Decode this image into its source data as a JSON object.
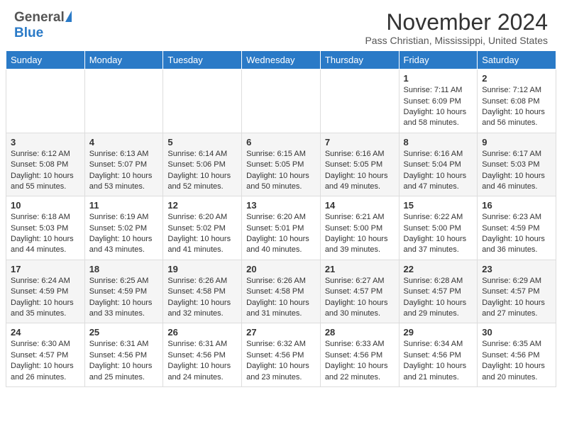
{
  "header": {
    "logo_general": "General",
    "logo_blue": "Blue",
    "month": "November 2024",
    "location": "Pass Christian, Mississippi, United States"
  },
  "calendar": {
    "days_of_week": [
      "Sunday",
      "Monday",
      "Tuesday",
      "Wednesday",
      "Thursday",
      "Friday",
      "Saturday"
    ],
    "weeks": [
      [
        {
          "day": "",
          "info": ""
        },
        {
          "day": "",
          "info": ""
        },
        {
          "day": "",
          "info": ""
        },
        {
          "day": "",
          "info": ""
        },
        {
          "day": "",
          "info": ""
        },
        {
          "day": "1",
          "info": "Sunrise: 7:11 AM\nSunset: 6:09 PM\nDaylight: 10 hours\nand 58 minutes."
        },
        {
          "day": "2",
          "info": "Sunrise: 7:12 AM\nSunset: 6:08 PM\nDaylight: 10 hours\nand 56 minutes."
        }
      ],
      [
        {
          "day": "3",
          "info": "Sunrise: 6:12 AM\nSunset: 5:08 PM\nDaylight: 10 hours\nand 55 minutes."
        },
        {
          "day": "4",
          "info": "Sunrise: 6:13 AM\nSunset: 5:07 PM\nDaylight: 10 hours\nand 53 minutes."
        },
        {
          "day": "5",
          "info": "Sunrise: 6:14 AM\nSunset: 5:06 PM\nDaylight: 10 hours\nand 52 minutes."
        },
        {
          "day": "6",
          "info": "Sunrise: 6:15 AM\nSunset: 5:05 PM\nDaylight: 10 hours\nand 50 minutes."
        },
        {
          "day": "7",
          "info": "Sunrise: 6:16 AM\nSunset: 5:05 PM\nDaylight: 10 hours\nand 49 minutes."
        },
        {
          "day": "8",
          "info": "Sunrise: 6:16 AM\nSunset: 5:04 PM\nDaylight: 10 hours\nand 47 minutes."
        },
        {
          "day": "9",
          "info": "Sunrise: 6:17 AM\nSunset: 5:03 PM\nDaylight: 10 hours\nand 46 minutes."
        }
      ],
      [
        {
          "day": "10",
          "info": "Sunrise: 6:18 AM\nSunset: 5:03 PM\nDaylight: 10 hours\nand 44 minutes."
        },
        {
          "day": "11",
          "info": "Sunrise: 6:19 AM\nSunset: 5:02 PM\nDaylight: 10 hours\nand 43 minutes."
        },
        {
          "day": "12",
          "info": "Sunrise: 6:20 AM\nSunset: 5:02 PM\nDaylight: 10 hours\nand 41 minutes."
        },
        {
          "day": "13",
          "info": "Sunrise: 6:20 AM\nSunset: 5:01 PM\nDaylight: 10 hours\nand 40 minutes."
        },
        {
          "day": "14",
          "info": "Sunrise: 6:21 AM\nSunset: 5:00 PM\nDaylight: 10 hours\nand 39 minutes."
        },
        {
          "day": "15",
          "info": "Sunrise: 6:22 AM\nSunset: 5:00 PM\nDaylight: 10 hours\nand 37 minutes."
        },
        {
          "day": "16",
          "info": "Sunrise: 6:23 AM\nSunset: 4:59 PM\nDaylight: 10 hours\nand 36 minutes."
        }
      ],
      [
        {
          "day": "17",
          "info": "Sunrise: 6:24 AM\nSunset: 4:59 PM\nDaylight: 10 hours\nand 35 minutes."
        },
        {
          "day": "18",
          "info": "Sunrise: 6:25 AM\nSunset: 4:59 PM\nDaylight: 10 hours\nand 33 minutes."
        },
        {
          "day": "19",
          "info": "Sunrise: 6:26 AM\nSunset: 4:58 PM\nDaylight: 10 hours\nand 32 minutes."
        },
        {
          "day": "20",
          "info": "Sunrise: 6:26 AM\nSunset: 4:58 PM\nDaylight: 10 hours\nand 31 minutes."
        },
        {
          "day": "21",
          "info": "Sunrise: 6:27 AM\nSunset: 4:57 PM\nDaylight: 10 hours\nand 30 minutes."
        },
        {
          "day": "22",
          "info": "Sunrise: 6:28 AM\nSunset: 4:57 PM\nDaylight: 10 hours\nand 29 minutes."
        },
        {
          "day": "23",
          "info": "Sunrise: 6:29 AM\nSunset: 4:57 PM\nDaylight: 10 hours\nand 27 minutes."
        }
      ],
      [
        {
          "day": "24",
          "info": "Sunrise: 6:30 AM\nSunset: 4:57 PM\nDaylight: 10 hours\nand 26 minutes."
        },
        {
          "day": "25",
          "info": "Sunrise: 6:31 AM\nSunset: 4:56 PM\nDaylight: 10 hours\nand 25 minutes."
        },
        {
          "day": "26",
          "info": "Sunrise: 6:31 AM\nSunset: 4:56 PM\nDaylight: 10 hours\nand 24 minutes."
        },
        {
          "day": "27",
          "info": "Sunrise: 6:32 AM\nSunset: 4:56 PM\nDaylight: 10 hours\nand 23 minutes."
        },
        {
          "day": "28",
          "info": "Sunrise: 6:33 AM\nSunset: 4:56 PM\nDaylight: 10 hours\nand 22 minutes."
        },
        {
          "day": "29",
          "info": "Sunrise: 6:34 AM\nSunset: 4:56 PM\nDaylight: 10 hours\nand 21 minutes."
        },
        {
          "day": "30",
          "info": "Sunrise: 6:35 AM\nSunset: 4:56 PM\nDaylight: 10 hours\nand 20 minutes."
        }
      ]
    ]
  }
}
